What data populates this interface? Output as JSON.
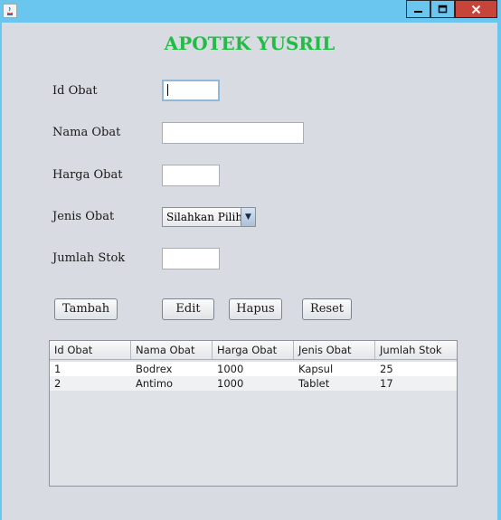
{
  "window": {
    "icon": "java-icon",
    "controls": [
      "minimize-icon",
      "maximize-icon",
      "close-icon"
    ]
  },
  "form": {
    "heading": "APOTEK YUSRIL",
    "labels": {
      "id": "Id Obat",
      "nama": "Nama Obat",
      "harga": "Harga Obat",
      "jenis": "Jenis Obat",
      "stok": "Jumlah Stok"
    },
    "values": {
      "id": "",
      "nama": "",
      "harga": "",
      "stok": ""
    },
    "jenis_selected": "Silahkan Pilih"
  },
  "buttons": {
    "tambah": "Tambah",
    "edit": "Edit",
    "hapus": "Hapus",
    "reset": "Reset"
  },
  "table": {
    "columns": [
      "Id Obat",
      "Nama Obat",
      "Harga Obat",
      "Jenis Obat",
      "Jumlah Stok"
    ],
    "rows": [
      [
        "1",
        "Bodrex",
        "1000",
        "Kapsul",
        "25"
      ],
      [
        "2",
        "Antimo",
        "1000",
        "Tablet",
        "17"
      ]
    ]
  },
  "colors": {
    "titlebar": "#6ac6ef",
    "heading": "#22bb44",
    "close_button": "#c7443a",
    "panel": "#d8dbe1"
  }
}
